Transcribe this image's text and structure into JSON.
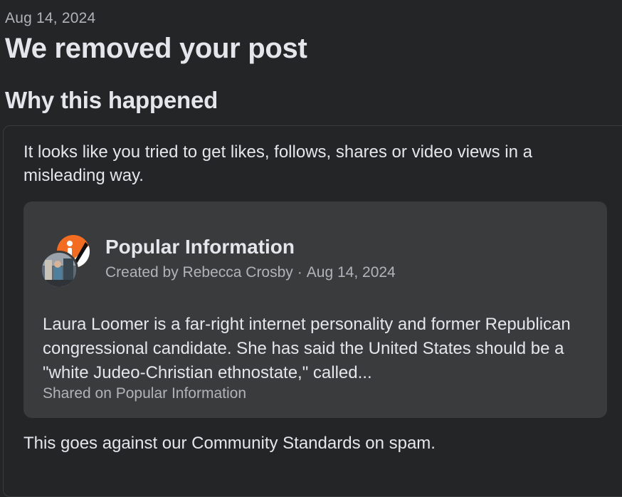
{
  "notice": {
    "date": "Aug 14, 2024",
    "title": "We removed your post",
    "section_heading": "Why this happened",
    "reason": "It looks like you tried to get likes, follows, shares or video views in a misleading way.",
    "standards_text": "This goes against our Community Standards on spam."
  },
  "post": {
    "page_name": "Popular Information",
    "created_by": "Created by Rebecca Crosby",
    "separator": "·",
    "date": "Aug 14, 2024",
    "text": "Laura Loomer is a far-right internet personality and former Republican congressional candidate. She has said the United States should be a \"white Judeo-Christian ethnostate,\" called...",
    "shared_on": "Shared on Popular Information"
  },
  "icons": {
    "page_avatar": "popular-information-logo",
    "user_avatar": "user-avatar-photo"
  },
  "colors": {
    "background": "#242526",
    "card": "#3a3b3c",
    "primary_text": "#e4e6eb",
    "secondary_text": "#b0b3b8",
    "page_logo_orange": "#f26c21"
  }
}
